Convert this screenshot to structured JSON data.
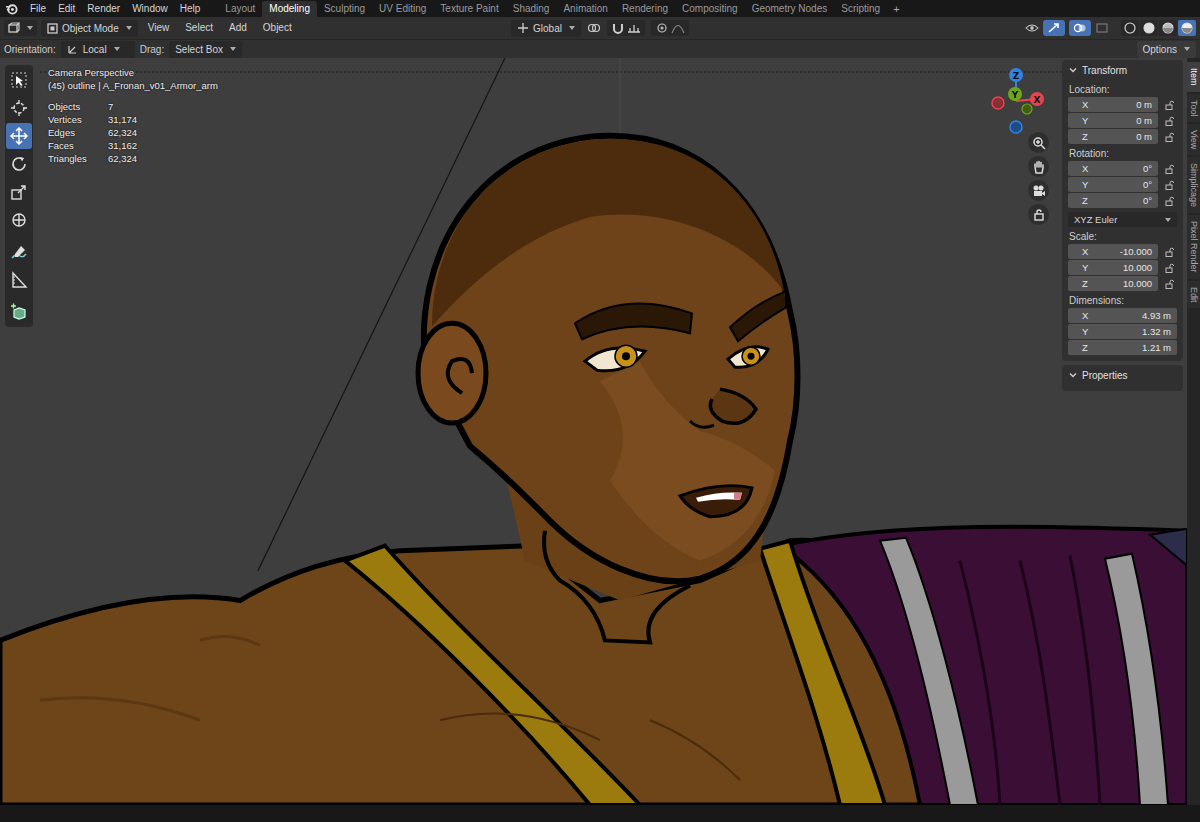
{
  "menu": [
    "File",
    "Edit",
    "Render",
    "Window",
    "Help"
  ],
  "workspaces": [
    {
      "label": "Layout",
      "selected": false
    },
    {
      "label": "Modeling",
      "selected": true
    },
    {
      "label": "Sculpting",
      "selected": false
    },
    {
      "label": "UV Editing",
      "selected": false
    },
    {
      "label": "Texture Paint",
      "selected": false
    },
    {
      "label": "Shading",
      "selected": false
    },
    {
      "label": "Animation",
      "selected": false
    },
    {
      "label": "Rendering",
      "selected": false
    },
    {
      "label": "Compositing",
      "selected": false
    },
    {
      "label": "Geometry Nodes",
      "selected": false
    },
    {
      "label": "Scripting",
      "selected": false
    }
  ],
  "workspace_add": "+",
  "header": {
    "mode": "Object Mode",
    "menus": [
      "View",
      "Select",
      "Add",
      "Object"
    ],
    "orientation": "Global"
  },
  "tool_settings": {
    "orientation_label": "Orientation:",
    "orientation": "Local",
    "drag_label": "Drag:",
    "drag": "Select Box",
    "options": "Options"
  },
  "viewport": {
    "view_name": "Camera Perspective",
    "object_info": "(45) outline | A_Fronan_v01_Armor_arm",
    "stats": [
      {
        "label": "Objects",
        "value": "7"
      },
      {
        "label": "Vertices",
        "value": "31,174"
      },
      {
        "label": "Edges",
        "value": "62,324"
      },
      {
        "label": "Faces",
        "value": "31,162"
      },
      {
        "label": "Triangles",
        "value": "62,324"
      }
    ]
  },
  "toolbar": [
    {
      "selected": false
    },
    {
      "selected": false
    },
    {
      "selected": true
    },
    {
      "selected": false
    },
    {
      "selected": false
    },
    {
      "selected": false
    },
    {
      "selected": false
    },
    {
      "selected": false
    },
    {
      "selected": false
    }
  ],
  "gizmo": {
    "axes": [
      {
        "label": "Z",
        "color": "#2f83e3"
      },
      {
        "label": "Y",
        "color": "#6ea51f"
      },
      {
        "label": "X",
        "color": "#e8434f"
      }
    ]
  },
  "shading_modes": [
    {
      "selected": false
    },
    {
      "selected": false
    },
    {
      "selected": false
    },
    {
      "selected": true
    }
  ],
  "sidebar": {
    "title": "Transform",
    "groups": [
      {
        "label": "Location:",
        "has_locks": true,
        "fields": [
          {
            "axis": "X",
            "value": "0 m"
          },
          {
            "axis": "Y",
            "value": "0 m"
          },
          {
            "axis": "Z",
            "value": "0 m"
          }
        ]
      },
      {
        "label": "Rotation:",
        "has_locks": true,
        "dropdown": "XYZ Euler",
        "fields": [
          {
            "axis": "X",
            "value": "0°"
          },
          {
            "axis": "Y",
            "value": "0°"
          },
          {
            "axis": "Z",
            "value": "0°"
          }
        ]
      },
      {
        "label": "Scale:",
        "has_locks": true,
        "fields": [
          {
            "axis": "X",
            "value": "-10.000"
          },
          {
            "axis": "Y",
            "value": "10.000"
          },
          {
            "axis": "Z",
            "value": "10.000"
          }
        ]
      },
      {
        "label": "Dimensions:",
        "has_locks": false,
        "fields": [
          {
            "axis": "X",
            "value": "4.93 m"
          },
          {
            "axis": "Y",
            "value": "1.32 m"
          },
          {
            "axis": "Z",
            "value": "1.21 m"
          }
        ]
      }
    ],
    "properties": "Properties"
  },
  "tabs": [
    {
      "label": "Item",
      "selected": true
    },
    {
      "label": "Tool",
      "selected": false
    },
    {
      "label": "View",
      "selected": false
    },
    {
      "label": "Simplicage",
      "selected": false
    },
    {
      "label": "Pixel Render",
      "selected": false
    },
    {
      "label": "Edit",
      "selected": false
    }
  ]
}
